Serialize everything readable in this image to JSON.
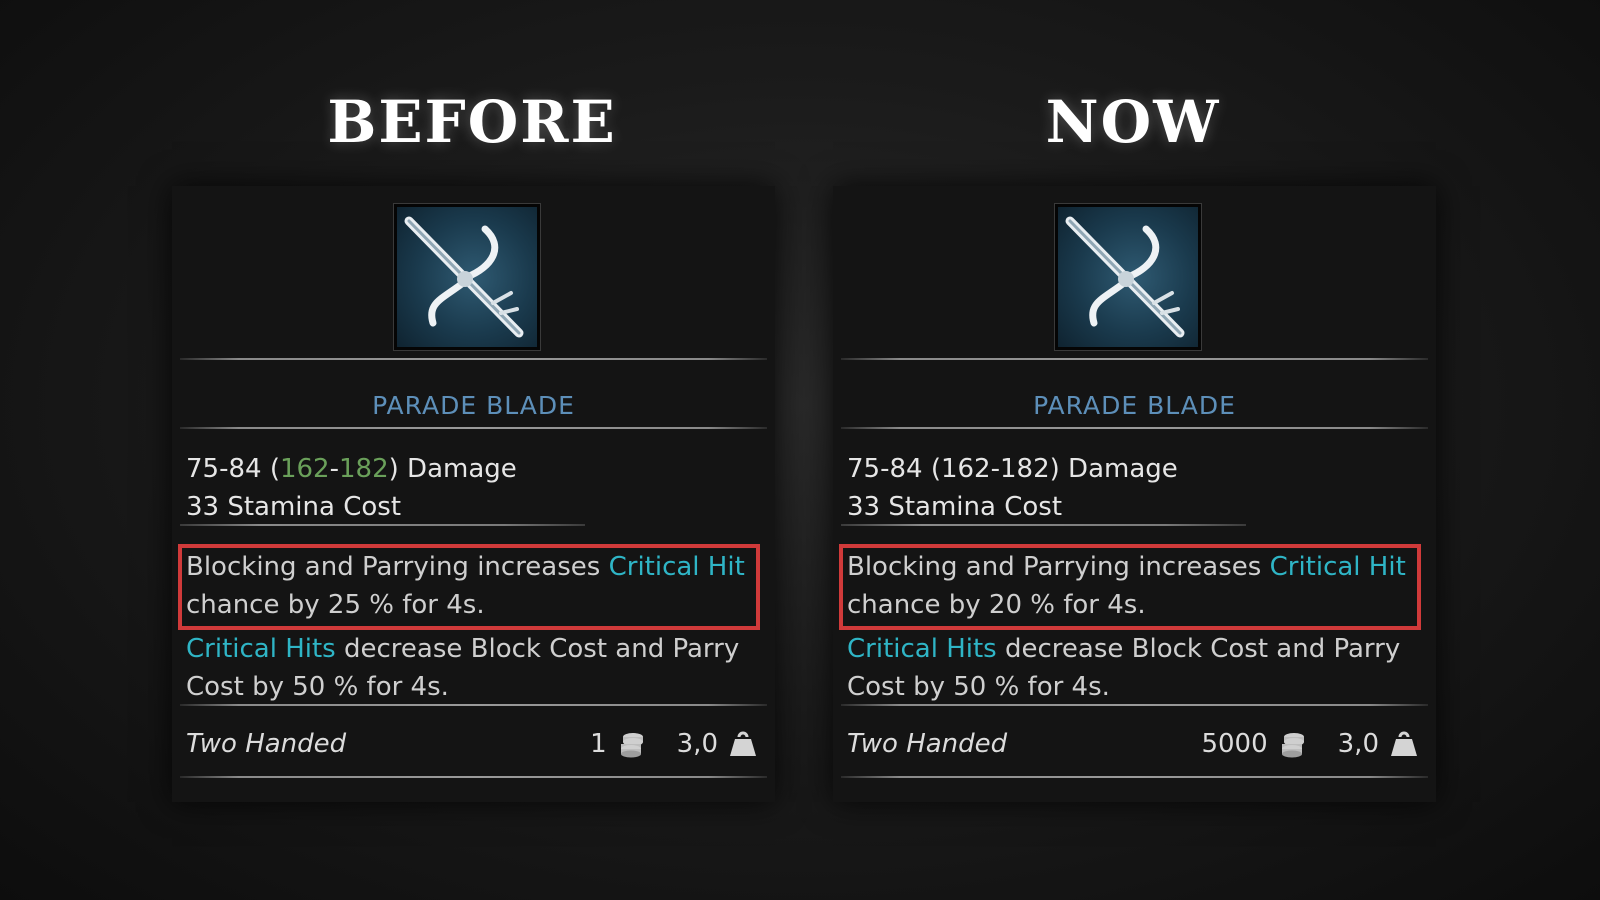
{
  "headings": {
    "before": "BEFORE",
    "now": "NOW"
  },
  "cards": [
    {
      "item_name": "PARADE BLADE",
      "damage": {
        "base": "75-84 (",
        "scaled_low": "162",
        "dash": "-",
        "scaled_high": "182",
        "suffix": ") Damage"
      },
      "stamina": "33 Stamina Cost",
      "effect1": {
        "pre": "Blocking and Parrying increases ",
        "crit": "Critical Hit",
        "post": " chance by 25 % for 4s."
      },
      "effect2": {
        "crit": "Critical Hits",
        "post": " decrease Block Cost and Parry Cost by 50 % for 4s."
      },
      "handedness": "Two Handed",
      "price": "1",
      "weight": "3,0"
    },
    {
      "item_name": "PARADE BLADE",
      "damage": {
        "base": "75-84 (",
        "scaled_low": "162",
        "dash": "-",
        "scaled_high": "182",
        "suffix": ") Damage"
      },
      "stamina": "33 Stamina Cost",
      "effect1": {
        "pre": "Blocking and Parrying increases ",
        "crit": "Critical Hit",
        "post": " chance by 20 % for 4s."
      },
      "effect2": {
        "crit": "Critical Hits",
        "post": " decrease Block Cost and Parry Cost by 50 % for 4s."
      },
      "handedness": "Two Handed",
      "price": "5000",
      "weight": "3,0"
    }
  ],
  "icons": {
    "item": "parade-blade-icon",
    "coins": "coins-icon",
    "weight": "weight-icon"
  },
  "colors": {
    "item_name": "#5d8fb9",
    "crit": "#2fb5c6",
    "scaled_damage": "#6aa05a",
    "highlight": "#d03a3a"
  }
}
